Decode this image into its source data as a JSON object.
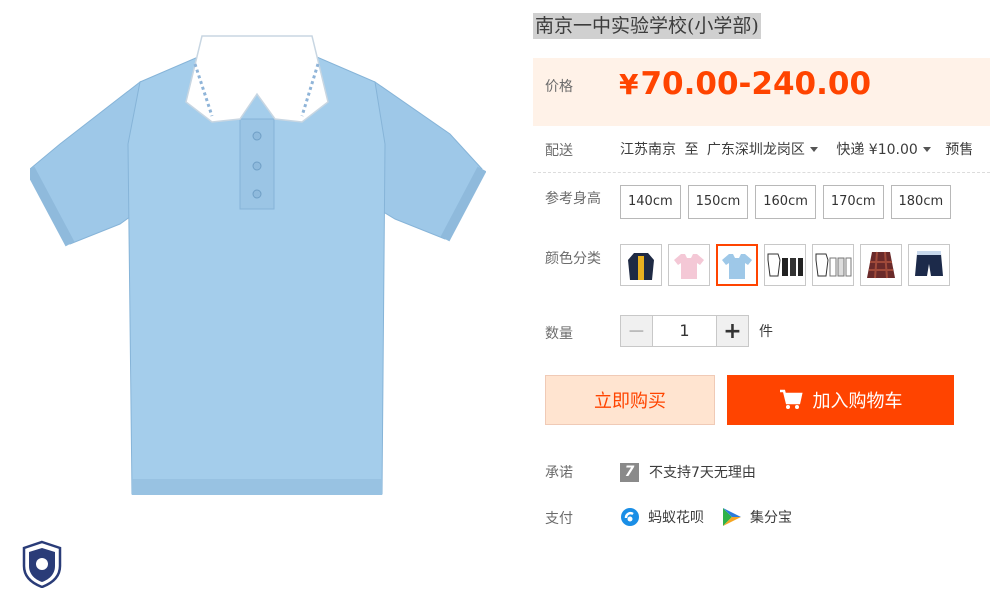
{
  "product": {
    "title": "南京一中实验学校(小学部)",
    "price_label": "价格",
    "currency": "¥",
    "price": "70.00-240.00"
  },
  "shipping": {
    "label": "配送",
    "from": "江苏南京",
    "to_word": "至",
    "to": "广东深圳龙岗区",
    "method": "快递 ¥10.00",
    "extra": "预售"
  },
  "size": {
    "label": "参考身高",
    "options": [
      "140cm",
      "150cm",
      "160cm",
      "170cm",
      "180cm"
    ]
  },
  "color": {
    "label": "颜色分类",
    "selected_index": 2
  },
  "quantity": {
    "label": "数量",
    "minus": "−",
    "value": "1",
    "plus": "+",
    "unit": "件"
  },
  "actions": {
    "buy_now": "立即购买",
    "add_to_cart": "加入购物车"
  },
  "promise": {
    "label": "承诺",
    "badge": "7",
    "text": "不支持7天无理由"
  },
  "payment": {
    "label": "支付",
    "methods": [
      "蚂蚁花呗",
      "集分宝"
    ]
  },
  "colors": {
    "accent": "#ff4400",
    "price_bg": "#fff2e8",
    "shirt": "#9ec8e8"
  }
}
